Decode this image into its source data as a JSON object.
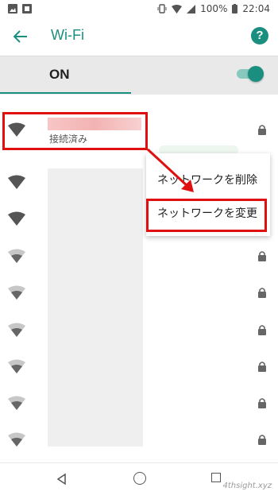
{
  "status_bar": {
    "battery": "100%",
    "time": "22:04"
  },
  "app_bar": {
    "title": "Wi-Fi",
    "help_label": "?"
  },
  "toggle_bar": {
    "label": "ON",
    "state": "on"
  },
  "networks": {
    "connected_status": "接続済み"
  },
  "context_menu": {
    "items": [
      {
        "label": "ネットワークを削除"
      },
      {
        "label": "ネットワークを変更"
      }
    ]
  },
  "watermark": "4thsight.xyz",
  "colors": {
    "accent": "#1a8f7f",
    "highlight": "#e01010"
  }
}
